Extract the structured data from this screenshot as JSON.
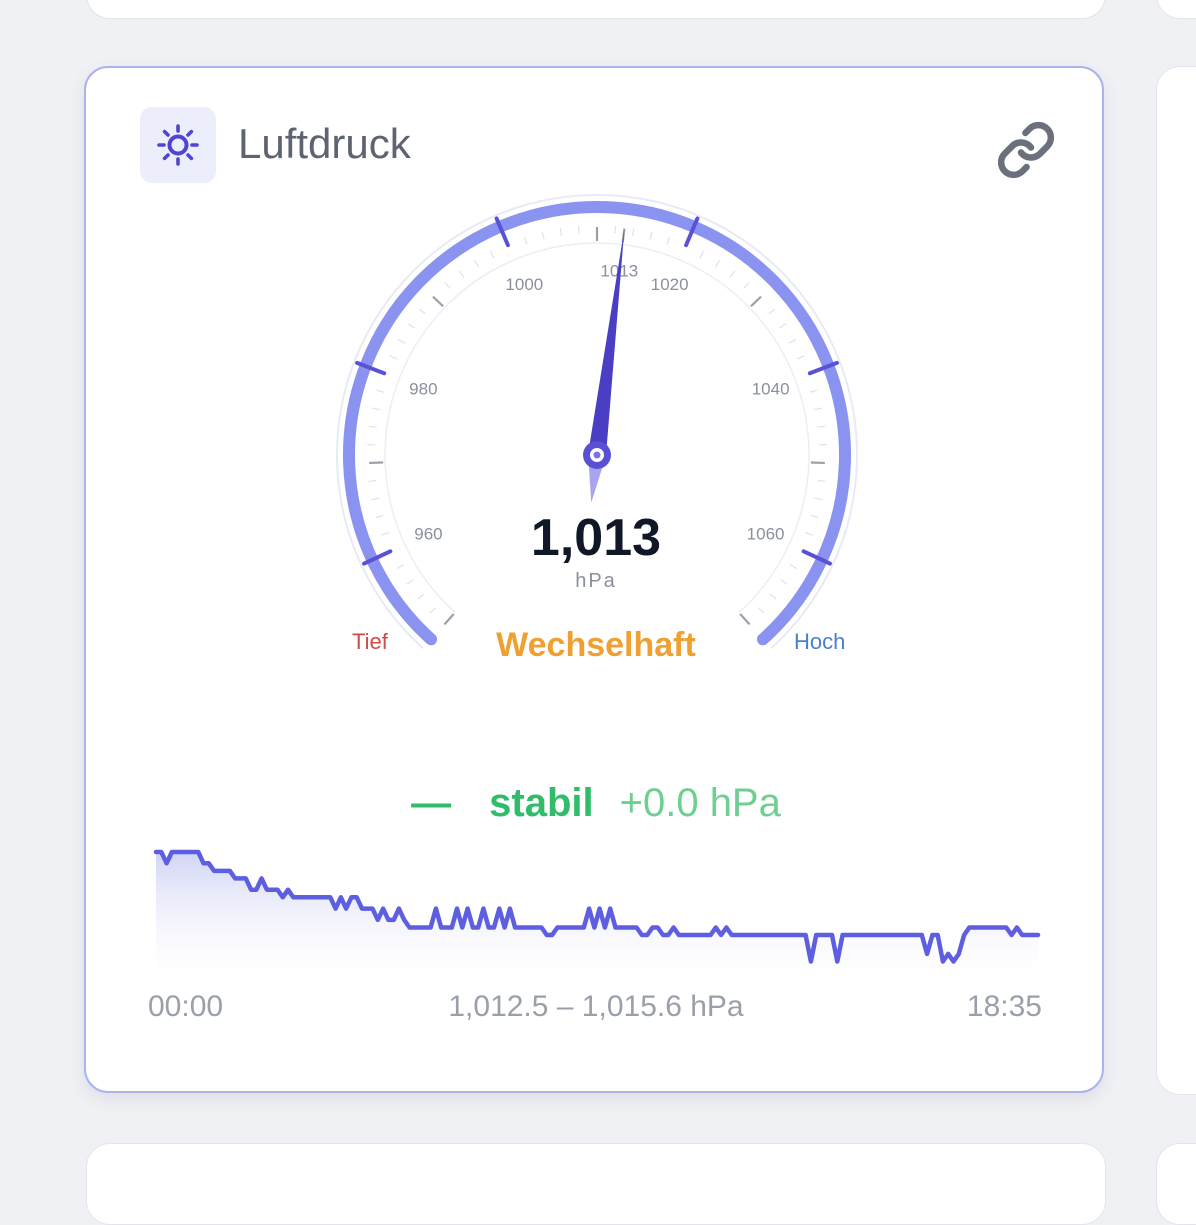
{
  "card": {
    "title": "Luftdruck",
    "icon": "sun-icon",
    "link_icon": "link-icon"
  },
  "gauge": {
    "min": 950,
    "max": 1070,
    "value": 1013,
    "value_display": "1,013",
    "unit": "hPa",
    "tick_labels": [
      "960",
      "980",
      "1000",
      "1013",
      "1020",
      "1040",
      "1060"
    ],
    "label_low": "Tief",
    "label_high": "Hoch",
    "status": "Wechselhaft",
    "colors": {
      "arc": "#8b93f0",
      "needle": "#4a3fc4",
      "status": "#f0a030"
    }
  },
  "trend": {
    "symbol": "—",
    "label": "stabil",
    "delta": "+0.0 hPa"
  },
  "sparkline": {
    "start_time": "00:00",
    "end_time": "18:35",
    "range_text": "1,012.5 – 1,015.6 hPa",
    "min": 1012.5,
    "max": 1015.6,
    "values": [
      1015.6,
      1015.6,
      1015.3,
      1015.6,
      1015.6,
      1015.6,
      1015.6,
      1015.6,
      1015.6,
      1015.3,
      1015.3,
      1015.1,
      1015.1,
      1015.1,
      1015.1,
      1014.9,
      1014.9,
      1014.9,
      1014.6,
      1014.6,
      1014.9,
      1014.6,
      1014.6,
      1014.6,
      1014.4,
      1014.6,
      1014.4,
      1014.4,
      1014.4,
      1014.4,
      1014.4,
      1014.4,
      1014.4,
      1014.4,
      1014.1,
      1014.4,
      1014.1,
      1014.4,
      1014.4,
      1014.1,
      1014.1,
      1014.1,
      1013.8,
      1014.1,
      1013.8,
      1013.8,
      1014.1,
      1013.8,
      1013.6,
      1013.6,
      1013.6,
      1013.6,
      1013.6,
      1014.1,
      1013.6,
      1013.6,
      1013.6,
      1014.1,
      1013.6,
      1014.1,
      1013.6,
      1013.6,
      1014.1,
      1013.6,
      1013.6,
      1014.1,
      1013.6,
      1014.1,
      1013.6,
      1013.6,
      1013.6,
      1013.6,
      1013.6,
      1013.6,
      1013.4,
      1013.4,
      1013.6,
      1013.6,
      1013.6,
      1013.6,
      1013.6,
      1013.6,
      1014.1,
      1013.6,
      1014.1,
      1013.6,
      1014.1,
      1013.6,
      1013.6,
      1013.6,
      1013.6,
      1013.6,
      1013.4,
      1013.4,
      1013.6,
      1013.6,
      1013.4,
      1013.4,
      1013.6,
      1013.4,
      1013.4,
      1013.4,
      1013.4,
      1013.4,
      1013.4,
      1013.4,
      1013.6,
      1013.4,
      1013.6,
      1013.4,
      1013.4,
      1013.4,
      1013.4,
      1013.4,
      1013.4,
      1013.4,
      1013.4,
      1013.4,
      1013.4,
      1013.4,
      1013.4,
      1013.4,
      1013.4,
      1013.4,
      1012.7,
      1013.4,
      1013.4,
      1013.4,
      1013.4,
      1012.7,
      1013.4,
      1013.4,
      1013.4,
      1013.4,
      1013.4,
      1013.4,
      1013.4,
      1013.4,
      1013.4,
      1013.4,
      1013.4,
      1013.4,
      1013.4,
      1013.4,
      1013.4,
      1013.4,
      1012.9,
      1013.4,
      1013.4,
      1012.7,
      1012.9,
      1012.7,
      1012.9,
      1013.4,
      1013.6,
      1013.6,
      1013.6,
      1013.6,
      1013.6,
      1013.6,
      1013.6,
      1013.6,
      1013.4,
      1013.6,
      1013.4,
      1013.4,
      1013.4,
      1013.4
    ]
  }
}
